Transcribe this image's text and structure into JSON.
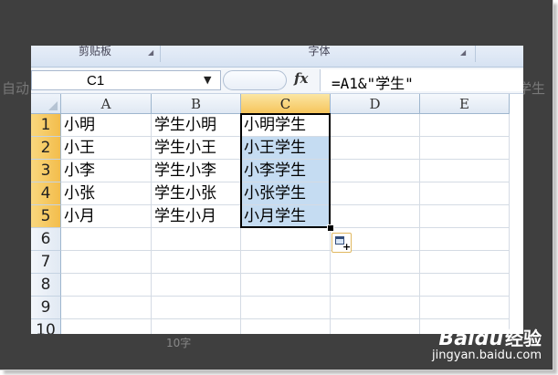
{
  "background": {
    "left_text": "自动",
    "right_text": "学生",
    "bottom_text": "10字"
  },
  "ribbon": {
    "groups": [
      "剪贴板",
      "字体"
    ]
  },
  "formula_bar": {
    "name_box": "C1",
    "formula": "=A1&\"学生\"",
    "fx_label": "fx"
  },
  "sheet": {
    "columns": [
      "A",
      "B",
      "C",
      "D",
      "E"
    ],
    "active_column": "C",
    "rows": [
      {
        "num": "1",
        "cells": [
          "小明",
          "学生小明",
          "小明学生",
          "",
          ""
        ]
      },
      {
        "num": "2",
        "cells": [
          "小王",
          "学生小王",
          "小王学生",
          "",
          ""
        ]
      },
      {
        "num": "3",
        "cells": [
          "小李",
          "学生小李",
          "小李学生",
          "",
          ""
        ]
      },
      {
        "num": "4",
        "cells": [
          "小张",
          "学生小张",
          "小张学生",
          "",
          ""
        ]
      },
      {
        "num": "5",
        "cells": [
          "小月",
          "学生小月",
          "小月学生",
          "",
          ""
        ]
      },
      {
        "num": "6",
        "cells": [
          "",
          "",
          "",
          "",
          ""
        ]
      },
      {
        "num": "7",
        "cells": [
          "",
          "",
          "",
          "",
          ""
        ]
      },
      {
        "num": "8",
        "cells": [
          "",
          "",
          "",
          "",
          ""
        ]
      },
      {
        "num": "9",
        "cells": [
          "",
          "",
          "",
          "",
          ""
        ]
      },
      {
        "num": "10",
        "cells": [
          "",
          "",
          "",
          "",
          ""
        ]
      }
    ],
    "selection": "C1:C5"
  },
  "watermark": {
    "logo": "Baidu",
    "logo_cn": "经验",
    "url": "jingyan.baidu.com"
  },
  "icons": [
    "chevron-down-icon",
    "fx-icon",
    "autofill-options-icon",
    "select-all-icon"
  ]
}
